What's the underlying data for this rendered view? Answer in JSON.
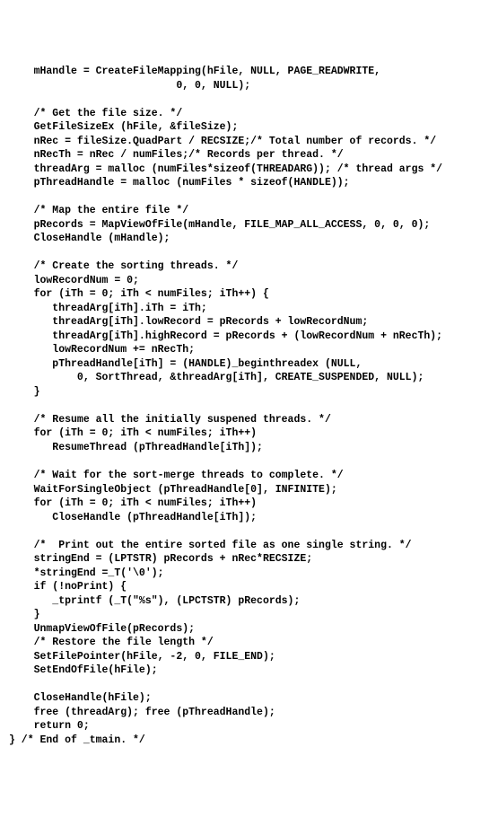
{
  "code": "    mHandle = CreateFileMapping(hFile, NULL, PAGE_READWRITE,\n                           0, 0, NULL);\n\n    /* Get the file size. */\n    GetFileSizeEx (hFile, &fileSize);\n    nRec = fileSize.QuadPart / RECSIZE;/* Total number of records. */\n    nRecTh = nRec / numFiles;/* Records per thread. */\n    threadArg = malloc (numFiles*sizeof(THREADARG)); /* thread args */\n    pThreadHandle = malloc (numFiles * sizeof(HANDLE));\n\n    /* Map the entire file */\n    pRecords = MapViewOfFile(mHandle, FILE_MAP_ALL_ACCESS, 0, 0, 0);\n    CloseHandle (mHandle);\n\n    /* Create the sorting threads. */\n    lowRecordNum = 0;\n    for (iTh = 0; iTh < numFiles; iTh++) {\n       threadArg[iTh].iTh = iTh;\n       threadArg[iTh].lowRecord = pRecords + lowRecordNum;\n       threadArg[iTh].highRecord = pRecords + (lowRecordNum + nRecTh);\n       lowRecordNum += nRecTh;\n       pThreadHandle[iTh] = (HANDLE)_beginthreadex (NULL,\n           0, SortThread, &threadArg[iTh], CREATE_SUSPENDED, NULL);\n    }\n\n    /* Resume all the initially suspened threads. */\n    for (iTh = 0; iTh < numFiles; iTh++)\n       ResumeThread (pThreadHandle[iTh]);\n\n    /* Wait for the sort-merge threads to complete. */\n    WaitForSingleObject (pThreadHandle[0], INFINITE);\n    for (iTh = 0; iTh < numFiles; iTh++)\n       CloseHandle (pThreadHandle[iTh]);\n\n    /*  Print out the entire sorted file as one single string. */\n    stringEnd = (LPTSTR) pRecords + nRec*RECSIZE;\n    *stringEnd =_T('\\0');\n    if (!noPrint) {\n       _tprintf (_T(\"%s\"), (LPCTSTR) pRecords);\n    }\n    UnmapViewOfFile(pRecords);\n    /* Restore the file length */\n    SetFilePointer(hFile, -2, 0, FILE_END);\n    SetEndOfFile(hFile);\n\n    CloseHandle(hFile);\n    free (threadArg); free (pThreadHandle);\n    return 0;\n} /* End of _tmain. */"
}
